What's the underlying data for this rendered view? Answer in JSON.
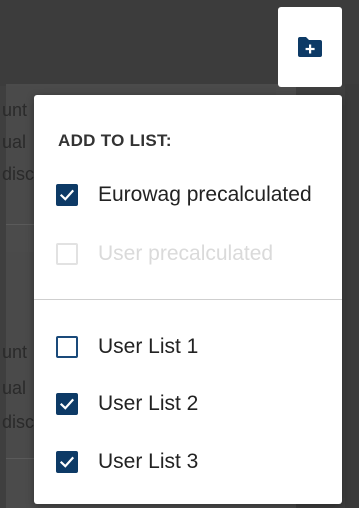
{
  "background": {
    "fragments": [
      "unt",
      "ual",
      "disc",
      "unt",
      "ual",
      "disc"
    ]
  },
  "folder_button": {
    "icon": "folder-plus-icon",
    "color": "#0d3a66"
  },
  "menu": {
    "title": "ADD TO LIST:",
    "sections": [
      [
        {
          "label": "Eurowag precalculated",
          "checked": true,
          "disabled": false
        },
        {
          "label": "User precalculated",
          "checked": false,
          "disabled": true
        }
      ],
      [
        {
          "label": "User List 1",
          "checked": false,
          "disabled": false
        },
        {
          "label": "User List 2",
          "checked": true,
          "disabled": false
        },
        {
          "label": "User List 3",
          "checked": true,
          "disabled": false
        }
      ]
    ]
  },
  "colors": {
    "accent": "#0d3a66",
    "disabled": "#dadada"
  }
}
